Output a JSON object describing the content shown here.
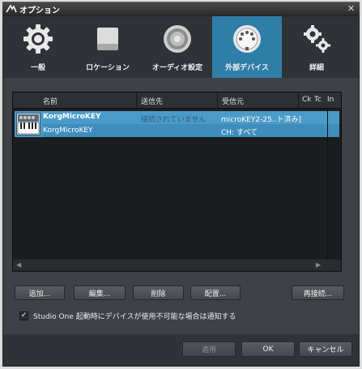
{
  "window": {
    "title": "オプション"
  },
  "tabs": [
    {
      "label": "一般",
      "icon": "gear-icon",
      "active": false
    },
    {
      "label": "ロケーション",
      "icon": "drive-icon",
      "active": false
    },
    {
      "label": "オーディオ設定",
      "icon": "speaker-icon",
      "active": false
    },
    {
      "label": "外部デバイス",
      "icon": "midi-port-icon",
      "active": true
    },
    {
      "label": "詳細",
      "icon": "gears-icon",
      "active": false
    }
  ],
  "table": {
    "columns": [
      "名前",
      "送信先",
      "受信元",
      "Ck",
      "Tc",
      "In"
    ],
    "rows": [
      {
        "name": "KorgMicroKEY",
        "name_sub": "KorgMicroKEY",
        "send": "接続されていません",
        "receive": "microKEY2-25..ト済み]",
        "receive_sub": "CH: すべて",
        "selected": true,
        "icon": "keyboard-icon"
      }
    ]
  },
  "buttons": {
    "add": "追加...",
    "edit": "編集...",
    "delete": "削除",
    "placement": "配置...",
    "reconnect": "再接続..."
  },
  "notify_checkbox": {
    "label": "Studio One 起動時にデバイスが使用不可能な場合は通知する",
    "checked": true,
    "mark": "✓"
  },
  "footer": {
    "apply": "適用",
    "ok": "OK",
    "cancel": "キャンセル"
  },
  "colors": {
    "accent": "#2f7ea8",
    "selection": "#4b9bc8"
  }
}
